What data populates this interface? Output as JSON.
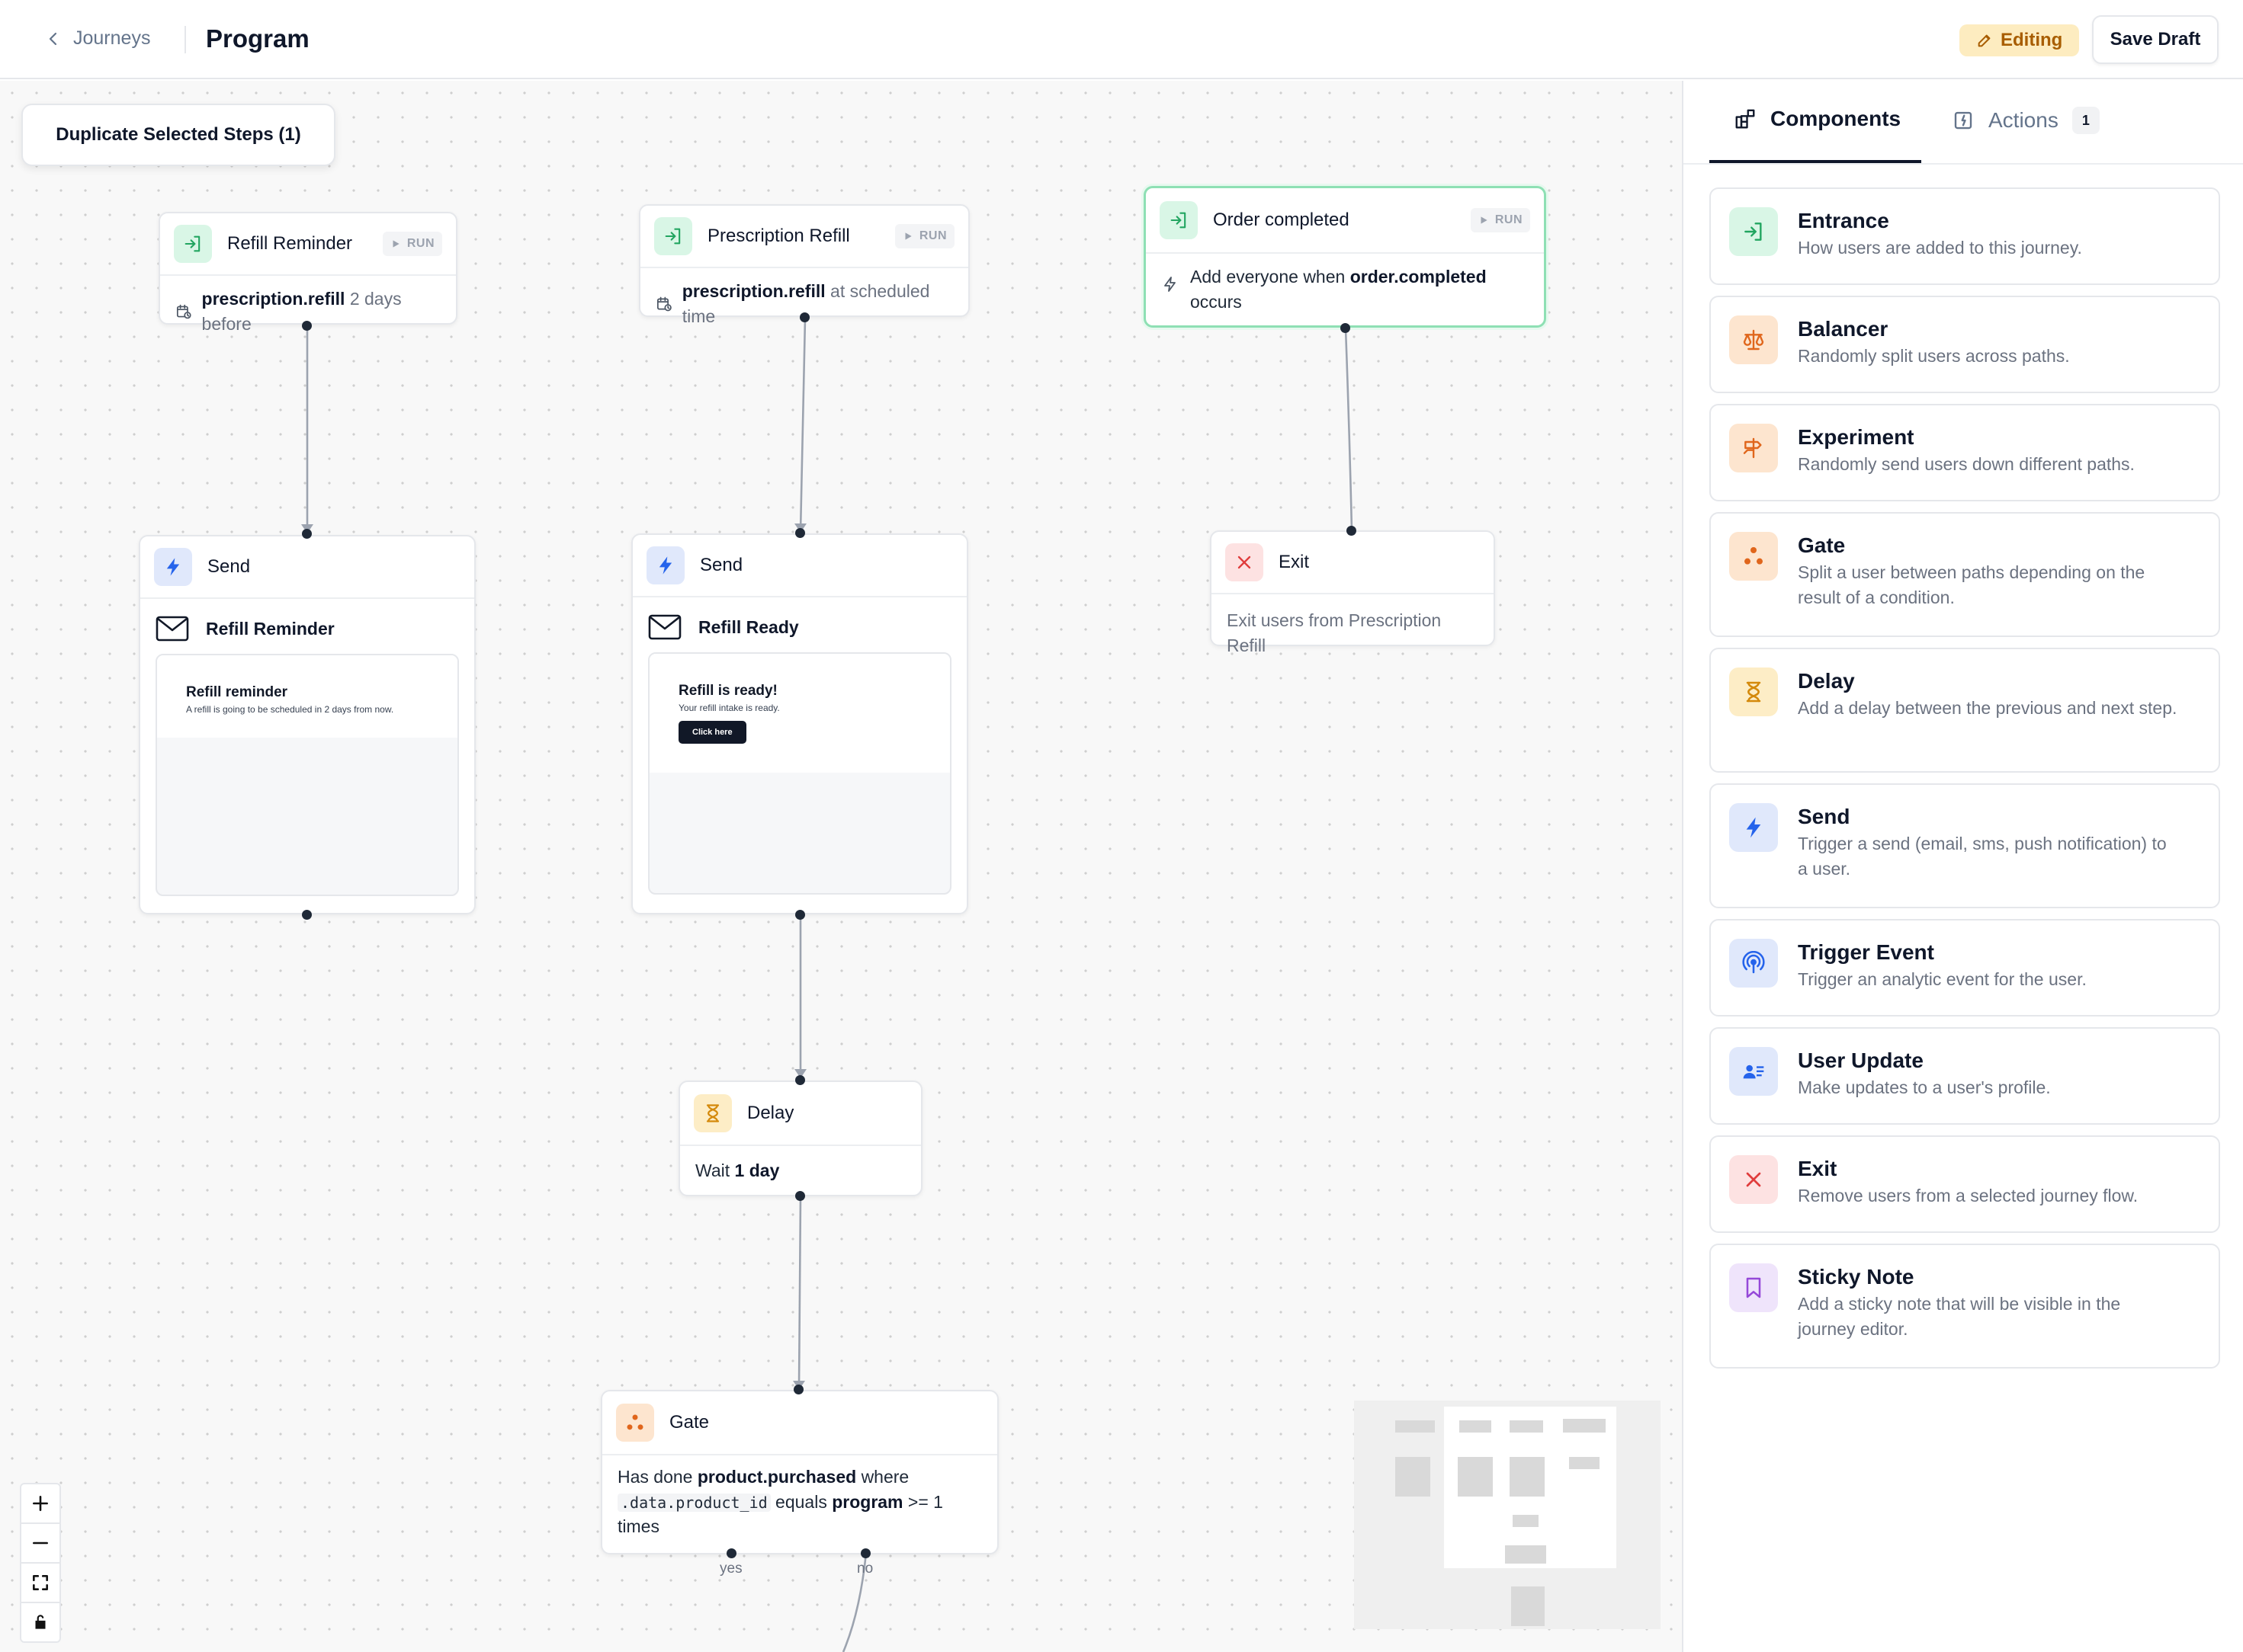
{
  "header": {
    "back_label": "Journeys",
    "title": "Program",
    "status_badge": "Editing",
    "save_label": "Save Draft"
  },
  "canvas": {
    "duplicate_button": "Duplicate Selected Steps (1)",
    "run_label": "RUN",
    "nodes": {
      "refill_reminder_entry": {
        "title": "Refill Reminder",
        "event": "prescription.refill",
        "timing": "2 days before"
      },
      "prescription_refill_entry": {
        "title": "Prescription Refill",
        "event": "prescription.refill",
        "timing": "at scheduled time"
      },
      "order_completed_entry": {
        "title": "Order completed",
        "prefix": "Add everyone when",
        "event": "order.completed",
        "suffix": "occurs"
      },
      "send_left": {
        "title": "Send",
        "template": "Refill Reminder",
        "preview_heading": "Refill reminder",
        "preview_text": "A refill is going to be scheduled in 2 days from now."
      },
      "send_middle": {
        "title": "Send",
        "template": "Refill Ready",
        "preview_heading": "Refill is ready!",
        "preview_text": "Your refill intake is ready.",
        "preview_button": "Click here"
      },
      "exit": {
        "title": "Exit",
        "description": "Exit users from Prescription Refill"
      },
      "delay": {
        "title": "Delay",
        "prefix": "Wait",
        "value": "1 day"
      },
      "gate": {
        "title": "Gate",
        "t1": "Has done",
        "event": "product.purchased",
        "t2": "where",
        "code": ".data.product_id",
        "t3": "equals",
        "value": "program",
        "t4": ">= 1",
        "t5": "times",
        "yes_label": "yes",
        "no_label": "no"
      }
    }
  },
  "sidebar": {
    "tabs": [
      {
        "label": "Components",
        "icon": "components-icon"
      },
      {
        "label": "Actions",
        "icon": "actions-icon",
        "count": "1"
      }
    ],
    "components": [
      {
        "title": "Entrance",
        "desc": "How users are added to this journey.",
        "icon": "entrance-icon",
        "color": "#22a560"
      },
      {
        "title": "Balancer",
        "desc": "Randomly split users across paths.",
        "icon": "scale-icon",
        "color": "#e0661c"
      },
      {
        "title": "Experiment",
        "desc": "Randomly send users down different paths.",
        "icon": "signpost-icon",
        "color": "#e0661c"
      },
      {
        "title": "Gate",
        "desc": "Split a user between paths depending on the result of a condition.",
        "icon": "gate-icon",
        "color": "#e0661c"
      },
      {
        "title": "Delay",
        "desc": "Add a delay between the previous and next step.",
        "icon": "hourglass-icon",
        "color": "#d4890b"
      },
      {
        "title": "Send",
        "desc": "Trigger a send (email, sms, push notification) to a user.",
        "icon": "bolt-icon",
        "color": "#2563eb"
      },
      {
        "title": "Trigger Event",
        "desc": "Trigger an analytic event for the user.",
        "icon": "broadcast-icon",
        "color": "#2563eb"
      },
      {
        "title": "User Update",
        "desc": "Make updates to a user's profile.",
        "icon": "user-card-icon",
        "color": "#2563eb"
      },
      {
        "title": "Exit",
        "desc": "Remove users from a selected journey flow.",
        "icon": "close-icon",
        "color": "#e03c3c"
      },
      {
        "title": "Sticky Note",
        "desc": "Add a sticky note that will be visible in the journey editor.",
        "icon": "bookmark-icon",
        "color": "#9549d8"
      }
    ]
  },
  "controls": [
    {
      "icon": "zoom-in-icon"
    },
    {
      "icon": "zoom-out-icon"
    },
    {
      "icon": "fit-view-icon"
    },
    {
      "icon": "lock-icon"
    }
  ]
}
